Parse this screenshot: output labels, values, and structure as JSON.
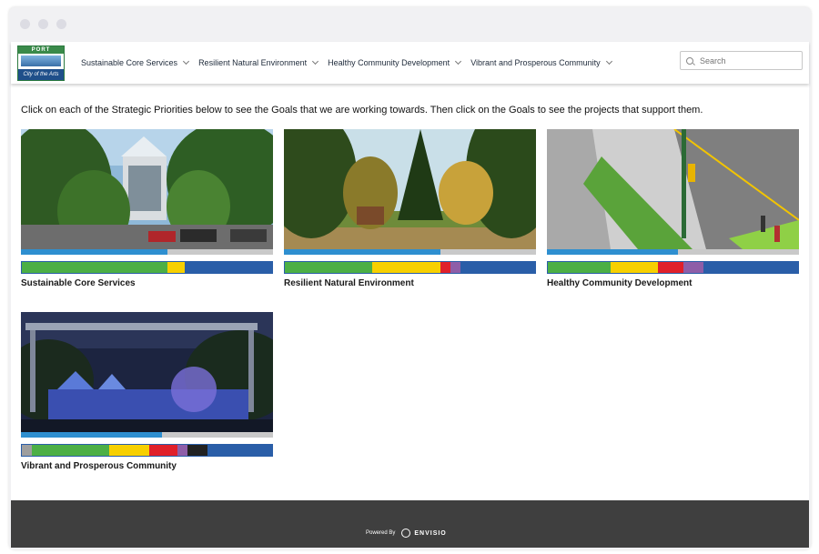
{
  "header": {
    "logo": {
      "top": "PORT MOODY",
      "bottom": "City of the Arts"
    },
    "nav": [
      {
        "label": "Sustainable Core Services"
      },
      {
        "label": "Resilient Natural Environment"
      },
      {
        "label": "Healthy Community Development"
      },
      {
        "label": "Vibrant and Prosperous Community"
      }
    ],
    "search": {
      "placeholder": "Search"
    }
  },
  "intro": "Click on each of the Strategic Priorities below to see the Goals that we are working towards. Then click on the Goals to see the projects that support them.",
  "cards": [
    {
      "title": "Sustainable Core Services",
      "progress": 0.58,
      "segments": [
        {
          "color": "#4caf45",
          "w": 0.58
        },
        {
          "color": "#f7d000",
          "w": 0.07
        },
        {
          "color": "#2a5ea8",
          "w": 0.35
        }
      ]
    },
    {
      "title": "Resilient Natural Environment",
      "progress": 0.62,
      "segments": [
        {
          "color": "#4caf45",
          "w": 0.35
        },
        {
          "color": "#f7d000",
          "w": 0.27
        },
        {
          "color": "#e0202a",
          "w": 0.04
        },
        {
          "color": "#8e5ea8",
          "w": 0.04
        },
        {
          "color": "#2a5ea8",
          "w": 0.3
        }
      ]
    },
    {
      "title": "Healthy Community Development",
      "progress": 0.52,
      "segments": [
        {
          "color": "#4caf45",
          "w": 0.25
        },
        {
          "color": "#f7d000",
          "w": 0.19
        },
        {
          "color": "#e0202a",
          "w": 0.1
        },
        {
          "color": "#8e5ea8",
          "w": 0.08
        },
        {
          "color": "#2a5ea8",
          "w": 0.38
        }
      ]
    },
    {
      "title": "Vibrant and Prosperous Community",
      "progress": 0.56,
      "segments": [
        {
          "color": "#9e9e9e",
          "w": 0.04
        },
        {
          "color": "#4caf45",
          "w": 0.31
        },
        {
          "color": "#f7d000",
          "w": 0.16
        },
        {
          "color": "#e0202a",
          "w": 0.11
        },
        {
          "color": "#8e5ea8",
          "w": 0.04
        },
        {
          "color": "#222222",
          "w": 0.08
        },
        {
          "color": "#2a5ea8",
          "w": 0.26
        }
      ]
    }
  ],
  "footer": {
    "powered_by": "Powered By",
    "brand": "ENVISIO"
  }
}
